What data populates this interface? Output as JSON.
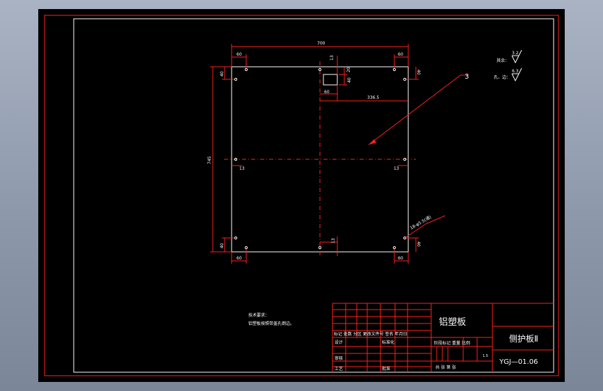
{
  "drawing": {
    "dimensions": {
      "overall_width": "700",
      "overall_height": "745",
      "top_left_edge": "60",
      "top_right_edge": "60",
      "left_top_edge": "40",
      "right_top_edge": "40",
      "cutout_width": "60",
      "cutout_center": "336.5",
      "cutout_top": "13",
      "cutout_small": "20",
      "cutout_height": "40",
      "mid_left": "13",
      "mid_right": "13",
      "bottom_center": "13",
      "left_bottom_edge": "40",
      "right_bottom_edge": "40",
      "bottom_left_edge": "60",
      "bottom_right_edge": "60",
      "holes_note": "18-φ5.5(通)",
      "thickness_callout": "3"
    },
    "roughness": {
      "remaining_label": "其余：",
      "remaining_value": "3.2",
      "hole_label": "孔、边：",
      "hole_value": "6.3"
    },
    "tech_requirements": {
      "title": "技术要求：",
      "line1": "铝塑板按照带盖孔倒边。"
    }
  },
  "title_block": {
    "material": "铝塑板",
    "part_name": "侧护板Ⅱ",
    "drawing_no": "YGJ—01.06",
    "scale": "1.5",
    "header_row": "标记 处数 分区 更改文件号 签名 年月日",
    "design_label": "设计",
    "standardization_label": "标准化",
    "stage_mark_label": "阶段标记 重量 比例",
    "check_label": "审核",
    "process_label": "工艺",
    "approve_label": "批准",
    "sheet_info": "共 张 第 张"
  }
}
